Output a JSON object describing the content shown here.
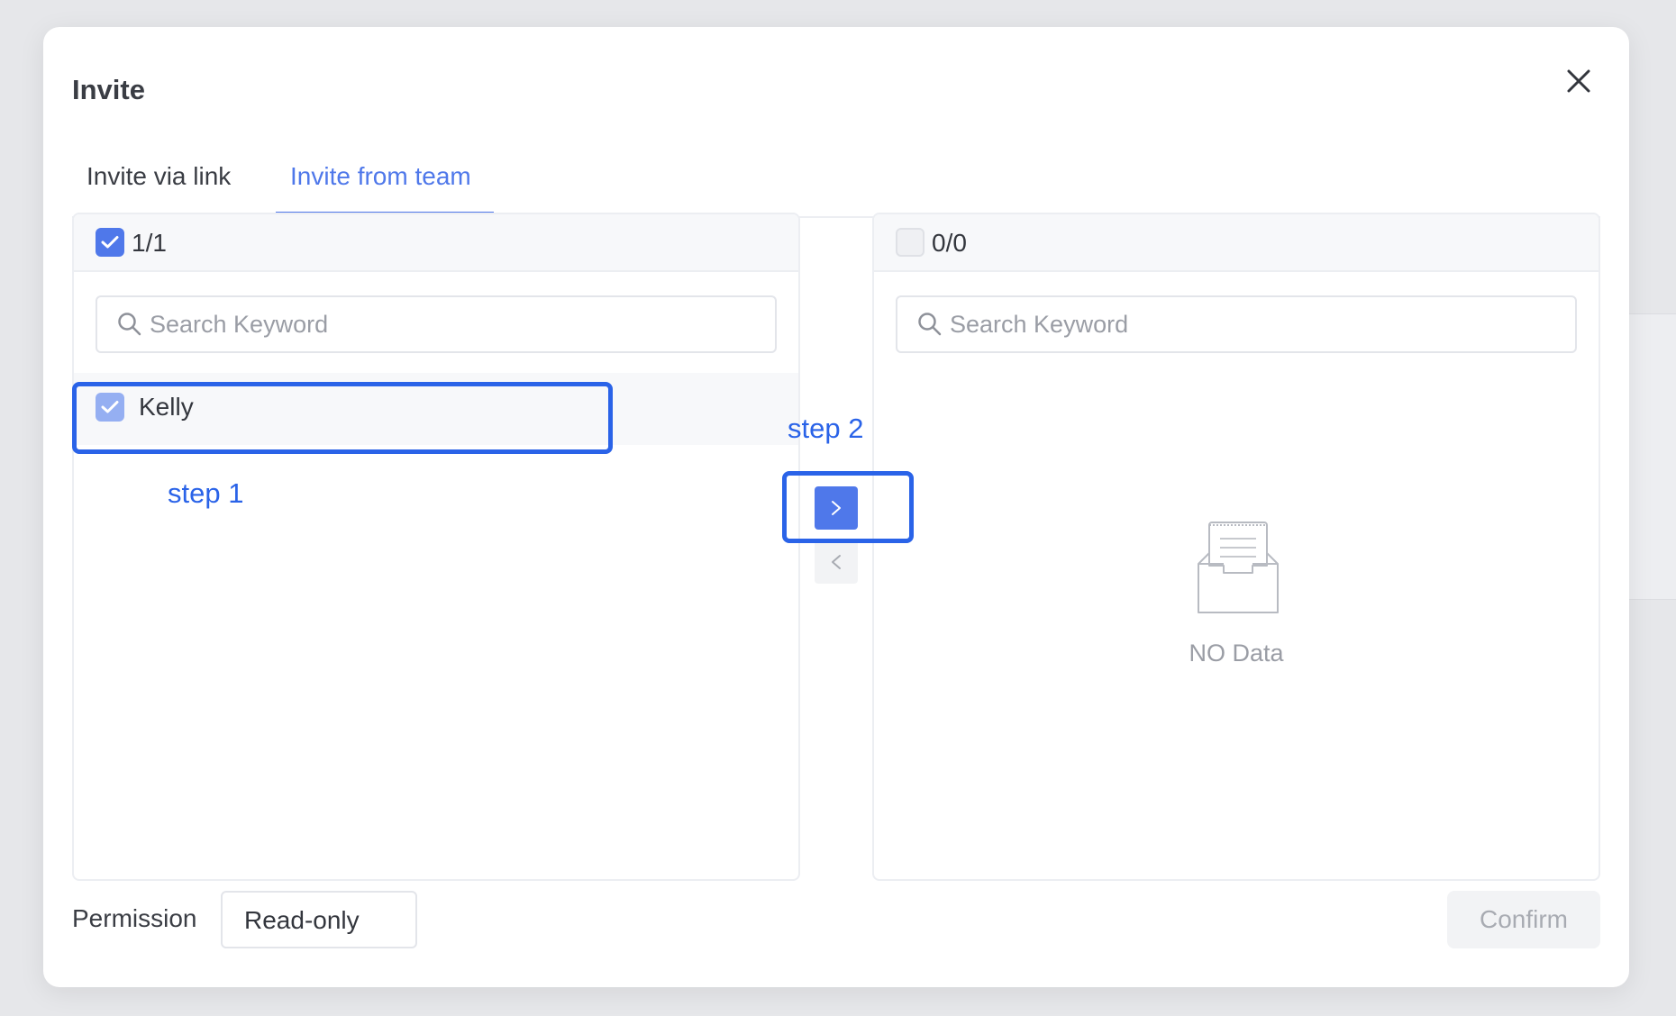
{
  "dialog": {
    "title": "Invite"
  },
  "tabs": [
    {
      "label": "Invite via link",
      "active": false
    },
    {
      "label": "Invite from team",
      "active": true
    }
  ],
  "source_panel": {
    "count": "1/1",
    "all_checked": true,
    "search_placeholder": "Search Keyword",
    "items": [
      {
        "label": "Kelly",
        "checked": true
      }
    ]
  },
  "target_panel": {
    "count": "0/0",
    "all_checked": false,
    "search_placeholder": "Search Keyword",
    "empty_text": "NO Data"
  },
  "transfer_buttons": {
    "to_right": ">",
    "to_left": "<"
  },
  "annotations": {
    "step1": "step 1",
    "step2": "step 2"
  },
  "footer": {
    "permission_label": "Permission",
    "permission_value": "Read-only",
    "confirm_label": "Confirm"
  },
  "colors": {
    "accent": "#4f78ea",
    "annotation": "#2a63e8",
    "disabled_text": "#a8abb2"
  },
  "icons": [
    "close-icon",
    "check-icon",
    "search-icon",
    "empty-inbox-icon",
    "chevron-right-icon",
    "chevron-left-icon"
  ]
}
